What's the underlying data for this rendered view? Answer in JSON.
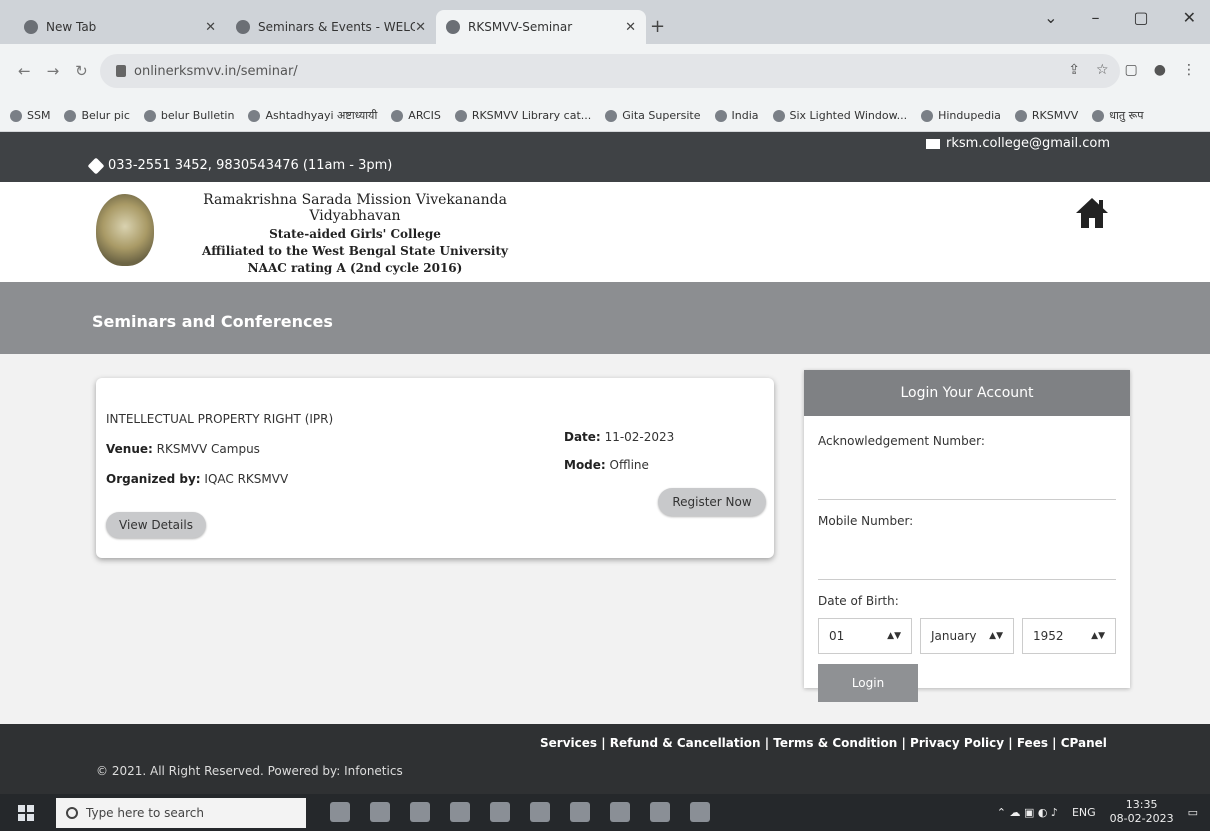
{
  "browser": {
    "tabs": [
      {
        "label": "New Tab",
        "active": false
      },
      {
        "label": "Seminars & Events - WELCOME",
        "active": false
      },
      {
        "label": "RKSMVV-Seminar",
        "active": true
      }
    ],
    "url": "onlinerksmvv.in/seminar/",
    "bookmarks": [
      "SSM",
      "Belur pic",
      "belur Bulletin",
      "Ashtadhyayi अष्टाध्यायी",
      "ARCIS",
      "RKSMVV Library cat...",
      "Gita Supersite",
      "India",
      "Six Lighted Window...",
      "Hindupedia",
      "RKSMVV",
      "धातु रूप"
    ]
  },
  "topbar": {
    "email": "rksm.college@gmail.com",
    "phone": "033-2551 3452, 9830543476 (11am - 3pm)"
  },
  "header": {
    "line1": "Ramakrishna Sarada Mission Vivekananda Vidyabhavan",
    "line2": "State-aided Girls' College",
    "line3": "Affiliated to the West Bengal State University",
    "line4": "NAAC rating A (2nd cycle 2016)"
  },
  "section": {
    "title": "Seminars and Conferences"
  },
  "seminar": {
    "title": "INTELLECTUAL PROPERTY RIGHT (IPR)",
    "venue_label": "Venue:",
    "venue": "RKSMVV Campus",
    "organized_label": "Organized by:",
    "organized": "IQAC RKSMVV",
    "date_label": "Date:",
    "date": "11-02-2023",
    "mode_label": "Mode:",
    "mode": "Offline",
    "view_label": "View Details",
    "register_label": "Register Now"
  },
  "login": {
    "heading": "Login Your Account",
    "ack_label": "Acknowledgement Number:",
    "mobile_label": "Mobile Number:",
    "dob_label": "Date of Birth:",
    "day": "01",
    "month": "January",
    "year": "1952",
    "button": "Login"
  },
  "footer": {
    "links": "Services | Refund & Cancellation | Terms & Condition | Privacy Policy | Fees | CPanel",
    "copyright": "© 2021. All Right Reserved. Powered by: Infonetics"
  },
  "taskbar": {
    "search_placeholder": "Type here to search",
    "lang": "ENG",
    "time": "13:35",
    "date": "08-02-2023"
  }
}
